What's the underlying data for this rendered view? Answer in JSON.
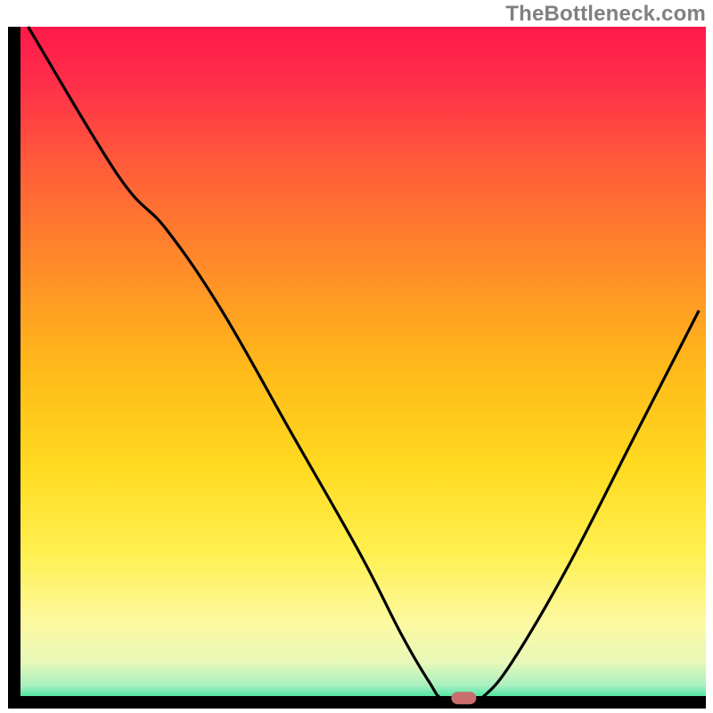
{
  "watermark": "TheBottleneck.com",
  "chart_data": {
    "type": "line",
    "title": "",
    "xlabel": "",
    "ylabel": "",
    "xlim": [
      0,
      100
    ],
    "ylim": [
      0,
      100
    ],
    "grid": false,
    "curve_points": [
      {
        "x": 2,
        "y": 100
      },
      {
        "x": 15,
        "y": 78
      },
      {
        "x": 22,
        "y": 70
      },
      {
        "x": 30,
        "y": 58
      },
      {
        "x": 40,
        "y": 40
      },
      {
        "x": 50,
        "y": 22
      },
      {
        "x": 56,
        "y": 10
      },
      {
        "x": 60,
        "y": 3
      },
      {
        "x": 62,
        "y": 0.5
      },
      {
        "x": 66,
        "y": 0.5
      },
      {
        "x": 68,
        "y": 1
      },
      {
        "x": 72,
        "y": 6
      },
      {
        "x": 80,
        "y": 20
      },
      {
        "x": 90,
        "y": 40
      },
      {
        "x": 99,
        "y": 58
      }
    ],
    "marker": {
      "x": 65,
      "y": 0.5,
      "color": "#c86e6e"
    },
    "gradient_stops": [
      {
        "offset": 0.0,
        "color": "#ff1a4a"
      },
      {
        "offset": 0.08,
        "color": "#ff2d4a"
      },
      {
        "offset": 0.2,
        "color": "#ff5a3a"
      },
      {
        "offset": 0.35,
        "color": "#ff8a2a"
      },
      {
        "offset": 0.5,
        "color": "#ffb81a"
      },
      {
        "offset": 0.65,
        "color": "#ffda20"
      },
      {
        "offset": 0.78,
        "color": "#fff050"
      },
      {
        "offset": 0.88,
        "color": "#fdf9a0"
      },
      {
        "offset": 0.94,
        "color": "#e8f8b8"
      },
      {
        "offset": 0.975,
        "color": "#a8f0c0"
      },
      {
        "offset": 1.0,
        "color": "#20e090"
      }
    ],
    "axis_color": "#000000",
    "curve_color": "#000000"
  }
}
